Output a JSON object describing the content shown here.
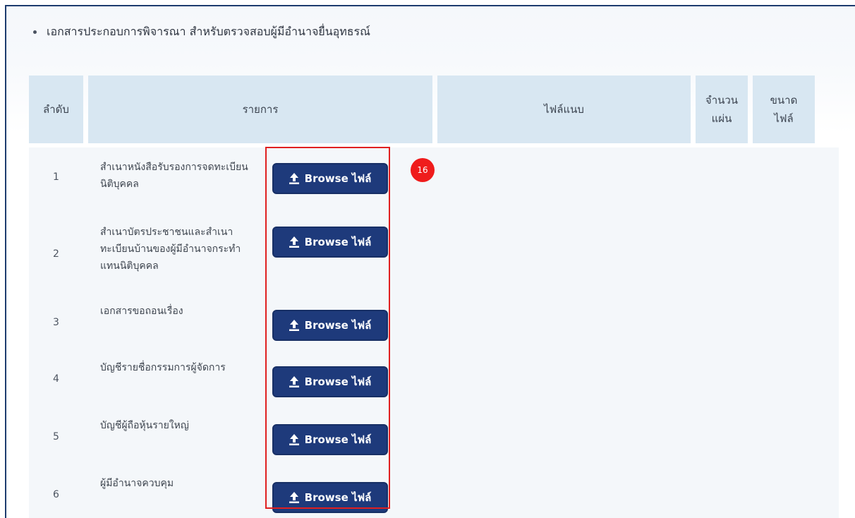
{
  "section": {
    "heading": "เอกสารประกอบการพิจารณา สำหรับตรวจสอบผู้มีอำนาจยื่นอุทธรณ์"
  },
  "table": {
    "headers": {
      "order": "ลำดับ",
      "item": "รายการ",
      "file": "ไฟล์แนบ",
      "count_line1": "จำนวน",
      "count_line2": "แผ่น",
      "size_line1": "ขนาด",
      "size_line2": "ไฟล์"
    },
    "rows": [
      {
        "num": "1",
        "label": "สำเนาหนังสือรับรองการจดทะเบียนนิติบุคคล"
      },
      {
        "num": "2",
        "label": "สำเนาบัตรประชาชนและสำเนาทะเบียนบ้านของผู้มีอำนาจกระทำแทนนิติบุคคล"
      },
      {
        "num": "3",
        "label": "เอกสารขอถอนเรื่อง"
      },
      {
        "num": "4",
        "label": "บัญชีรายชื่อกรรมการผู้จัดการ"
      },
      {
        "num": "5",
        "label": "บัญชีผู้ถือหุ้นรายใหญ่"
      },
      {
        "num": "6",
        "label": "ผู้มีอำนาจควบคุม"
      }
    ],
    "browse_label": "Browse ไฟล์"
  },
  "annotation": {
    "step_number": "16",
    "highlight_color": "#e02020"
  },
  "icons": {
    "upload": "upload-icon"
  },
  "colors": {
    "button_bg": "#1e3a7b",
    "header_bg": "#d8e7f2",
    "badge_bg": "#ef1c1c"
  }
}
